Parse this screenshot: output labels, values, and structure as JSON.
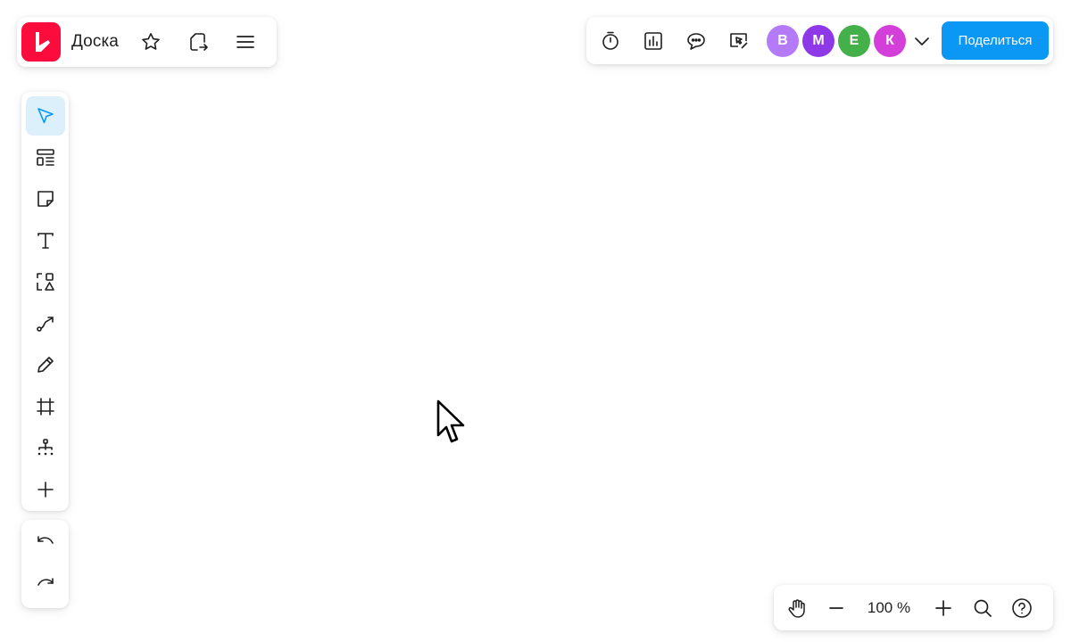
{
  "app": {
    "board_name": "Доска",
    "brand_color": "#fb0c3c",
    "accent_color": "#0b98f5"
  },
  "header": {
    "left_icons": [
      "logo-icon",
      "star-icon",
      "export-icon",
      "menu-icon"
    ],
    "right_tools": [
      "timer-icon",
      "poll-chart-icon",
      "comments-icon",
      "presentation-icon"
    ],
    "avatars": [
      {
        "letter": "В",
        "color": "#b57af7"
      },
      {
        "letter": "М",
        "color": "#8e38e8"
      },
      {
        "letter": "Е",
        "color": "#44b049"
      },
      {
        "letter": "К",
        "color": "#d43ed9"
      }
    ],
    "share_label": "Поделиться"
  },
  "toolbar": {
    "items": [
      "select-icon",
      "templates-icon",
      "sticker-icon",
      "text-icon",
      "shapes-icon",
      "connector-icon",
      "pen-icon",
      "frame-icon",
      "mindmap-icon",
      "add-icon"
    ],
    "active": "select-icon",
    "history": [
      "undo-icon",
      "redo-icon"
    ]
  },
  "zoom": {
    "level": "100 %"
  }
}
